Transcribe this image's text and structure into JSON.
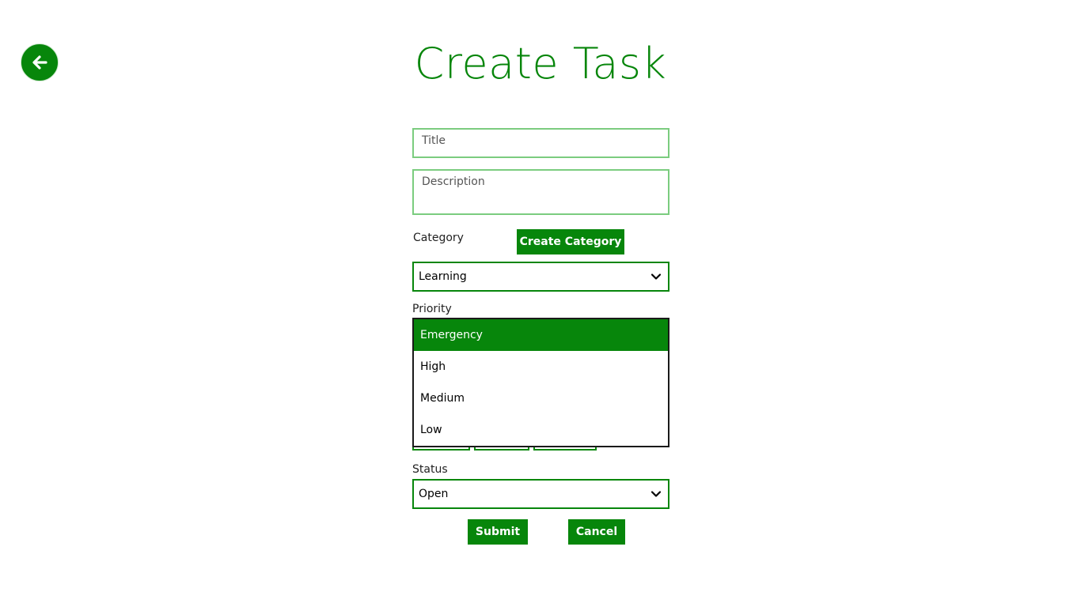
{
  "header": {
    "title": "Create Task",
    "back_icon": "arrow-left-icon"
  },
  "form": {
    "title_placeholder": "Title",
    "description_placeholder": "Description",
    "category_label": "Category",
    "create_category_label": "Create Category",
    "category_value": "Learning",
    "priority_label": "Priority",
    "priority_options": [
      "Emergency",
      "High",
      "Medium",
      "Low"
    ],
    "priority_selected": "Emergency",
    "status_label": "Status",
    "status_value": "Open",
    "submit_label": "Submit",
    "cancel_label": "Cancel"
  },
  "colors": {
    "accent": "#07860b",
    "field_border": "#7bcc7f",
    "background": "#ffffff"
  }
}
